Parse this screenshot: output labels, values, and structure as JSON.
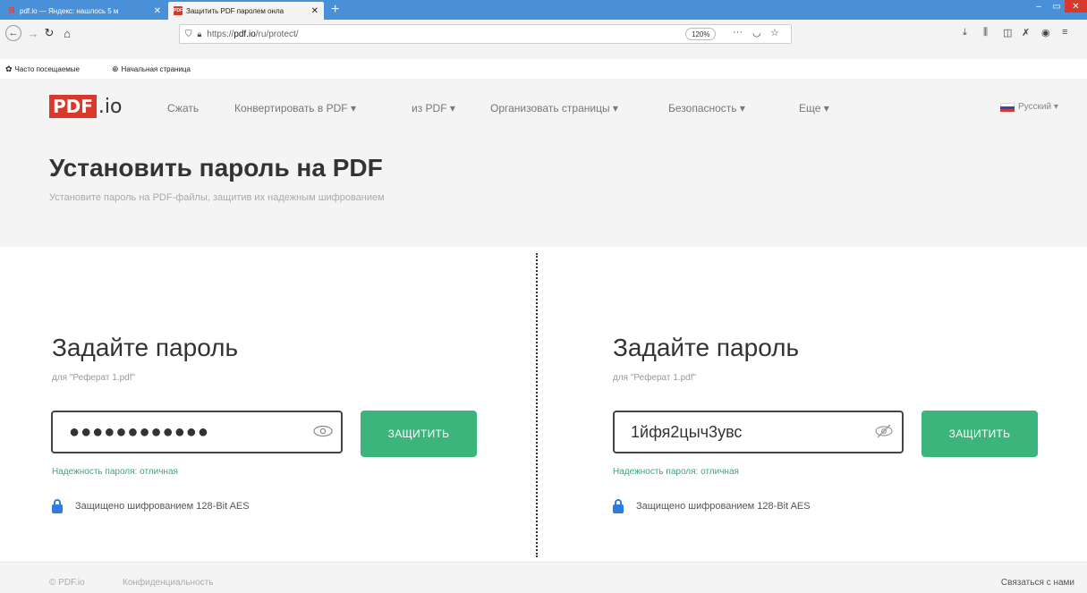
{
  "browser": {
    "tabs": [
      {
        "favicon": "Я",
        "title": "pdf.io — Яндекс: нашлось 5 м",
        "active": false
      },
      {
        "favicon": "PDF",
        "title": "Защитить PDF паролем онла",
        "active": true
      }
    ],
    "new_tab": "+",
    "url": {
      "prefix": "https://",
      "host": "pdf.io",
      "path": "/ru/protect/"
    },
    "zoom": "120%",
    "url_actions": [
      "more-icon",
      "pocket-icon",
      "star-icon"
    ],
    "toolbar_icons": [
      "download-icon",
      "library-icon",
      "sidebar-icon",
      "extension-icon",
      "account-icon",
      "menu-icon"
    ],
    "bookmarks": [
      {
        "icon": "gear-icon",
        "label": "Часто посещаемые"
      },
      {
        "icon": "globe-icon",
        "label": "Начальная страница"
      }
    ]
  },
  "site": {
    "logo": {
      "pdf": "PDF",
      "io": ".io"
    },
    "nav": [
      "Сжать",
      "Конвертировать в PDF ▾",
      "из PDF ▾",
      "Организовать страницы ▾",
      "Безопасность ▾",
      "Еще ▾"
    ],
    "language": "Русский ▾",
    "title": "Установить пароль на PDF",
    "subtitle": "Установите пароль на PDF-файлы, защитив их надежным шифрованием"
  },
  "panels": [
    {
      "title": "Задайте пароль",
      "file": "для \"Реферат 1.pdf\"",
      "password_display": "●●●●●●●●●●●●",
      "masked": true,
      "eye_icon": "eye-icon",
      "button": "ЗАЩИТИТЬ",
      "strength": "Надежность пароля: отличная",
      "encryption": "Защищено шифрованием 128-Bit AES"
    },
    {
      "title": "Задайте пароль",
      "file": "для \"Реферат 1.pdf\"",
      "password_display": "1йфя2цыч3увс",
      "masked": false,
      "eye_icon": "eye-slash-icon",
      "button": "ЗАЩИТИТЬ",
      "strength": "Надежность пароля: отличная",
      "encryption": "Защищено шифрованием 128-Bit AES"
    }
  ],
  "footer": {
    "copyright": "© PDF.io",
    "privacy": "Конфиденциальность",
    "contact": "Связаться с нами"
  },
  "colors": {
    "accent_green": "#3cb57d",
    "brand_red": "#d9392c",
    "lock_blue": "#2d7de0",
    "tabstrip_blue": "#4a90d9"
  }
}
